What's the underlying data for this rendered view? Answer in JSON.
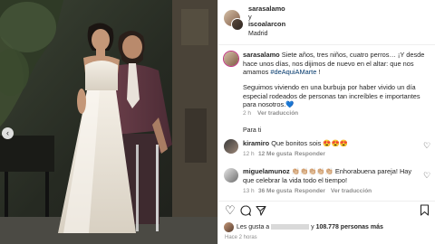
{
  "post": {
    "author": "sarasalamo",
    "connector": "y",
    "coauthor": "iscoalarcon",
    "location": "Madrid",
    "caption_user": "sarasalamo",
    "caption_text": "Siete años, tres niños, cuatro perros… ¡Y desde hace unos días, nos dijimos de nuevo en el altar: que nos amamos",
    "caption_hashtag": "#deAquiAMarte",
    "caption_end": "!",
    "caption_p2": "Seguimos viviendo en una burbuja por haber vivido un día especial rodeados de personas tan increíbles e importantes para nosotros.💙",
    "caption_time": "2 h",
    "see_translation": "Ver traducción"
  },
  "section_label": "Para ti",
  "comments": [
    {
      "user": "kiramiro",
      "text": "Que bonitos sois 😍😍😍",
      "time": "12 h",
      "likes": "12 Me gusta",
      "reply": "Responder"
    },
    {
      "user": "miguelamunoz",
      "text": "👏🏼👏🏼👏🏼👏🏼👏🏼 Enhorabuena pareja! Hay que celebrar la vida todo el tiempo!",
      "time": "13 h",
      "likes": "36 Me gusta",
      "reply": "Responder",
      "see_translation": "Ver traducción"
    }
  ],
  "likes_line": {
    "prefix": "Les gusta a",
    "middle": "y",
    "count": "108.778 personas más"
  },
  "timestamp": "Hace 2 horas",
  "colors": {
    "heart_red": "#ed4956",
    "blue_link": "#00376b",
    "muted": "#8e8e8e"
  }
}
